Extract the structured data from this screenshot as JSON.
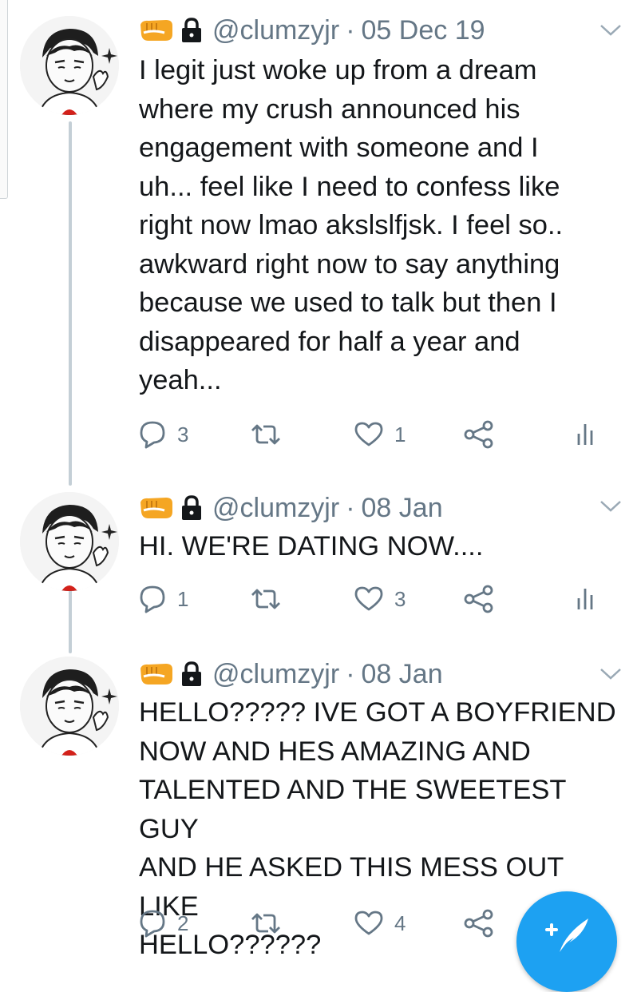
{
  "colors": {
    "accent": "#1da1f2",
    "secondary_text": "#657786",
    "thread_line": "#c4cfd6"
  },
  "tweets": [
    {
      "handle": "@clumzyjr",
      "separator": "·",
      "date": "05 Dec 19",
      "text": "I legit just woke up from a dream\nwhere my crush announced his\nengagement with someone and I\nuh... feel like I need to confess like\nright now lmao akslslfjsk. I feel so..\nawkward right now to say anything\nbecause we used to talk but then I\ndisappeared for half a year and\nyeah...",
      "replies": "3",
      "retweets": "",
      "likes": "1"
    },
    {
      "handle": "@clumzyjr",
      "separator": "·",
      "date": "08 Jan",
      "text": "HI. WE'RE DATING NOW....",
      "replies": "1",
      "retweets": "",
      "likes": "3"
    },
    {
      "handle": "@clumzyjr",
      "separator": "·",
      "date": "08 Jan",
      "text": "HELLO????? IVE GOT A BOYFRIEND\nNOW AND HES AMAZING AND\nTALENTED AND THE SWEETEST GUY\nAND HE ASKED THIS MESS OUT LIKE\nHELLO??????",
      "replies": "2",
      "retweets": "",
      "likes": "4"
    }
  ],
  "icons": {
    "badge": "fist-emoji-icon",
    "lock": "lock-icon",
    "menu": "chevron-down-icon",
    "reply": "reply-icon",
    "retweet": "retweet-icon",
    "like": "heart-icon",
    "share": "share-icon",
    "analytics": "analytics-icon",
    "compose": "compose-tweet-icon"
  }
}
